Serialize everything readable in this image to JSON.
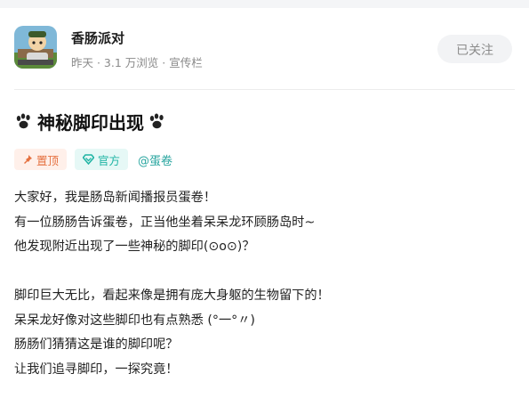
{
  "author": {
    "name": "香肠派对",
    "meta": "昨天 · 3.1 万浏览 · 宣传栏"
  },
  "follow_label": "已关注",
  "post": {
    "title": "神秘脚印出现",
    "tags": {
      "top_label": "置顶",
      "official_label": "官方",
      "mention": "@蛋卷"
    },
    "paragraph1": [
      "大家好，我是肠岛新闻播报员蛋卷！",
      "有一位肠肠告诉蛋卷，正当他坐着呆呆龙环顾肠岛时~",
      "他发现附近出现了一些神秘的脚印(⊙o⊙)？"
    ],
    "paragraph2": [
      "脚印巨大无比，看起来像是拥有庞大身躯的生物留下的！",
      "呆呆龙好像对这些脚印也有点熟悉 (°一°〃)",
      "肠肠们猜猜这是谁的脚印呢？",
      "让我们追寻脚印，一探究竟！"
    ]
  },
  "colors": {
    "top_tag": "#e5703f",
    "official_tag": "#1fb4a4",
    "mention": "#2aa6a0"
  }
}
